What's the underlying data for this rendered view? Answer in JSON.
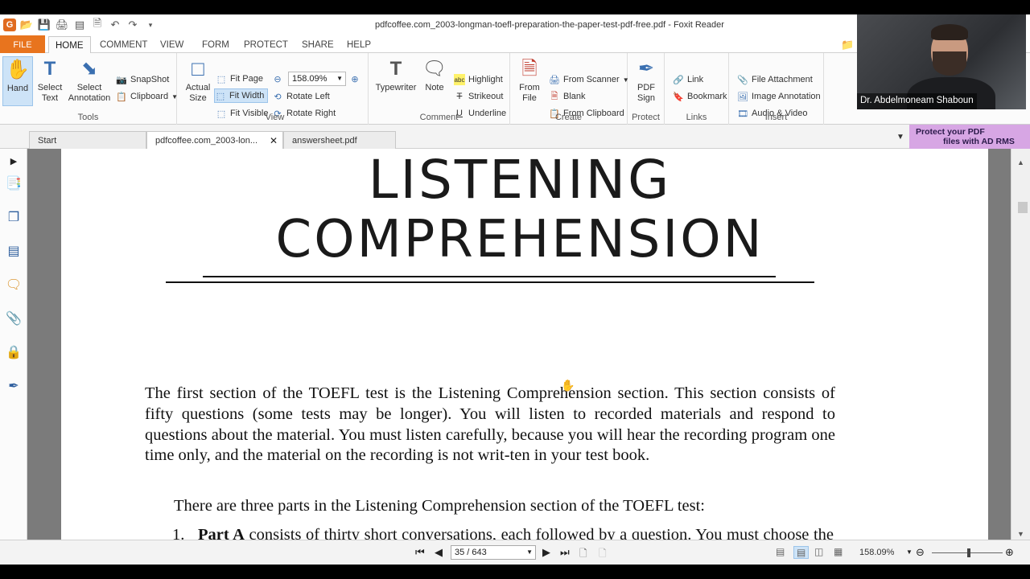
{
  "window": {
    "title": "pdfcoffee.com_2003-longman-toefl-preparation-the-paper-test-pdf-free.pdf - Foxit Reader"
  },
  "ribbon_tabs": [
    {
      "label": "FILE"
    },
    {
      "label": "HOME"
    },
    {
      "label": "COMMENT"
    },
    {
      "label": "VIEW"
    },
    {
      "label": "FORM"
    },
    {
      "label": "PROTECT"
    },
    {
      "label": "SHARE"
    },
    {
      "label": "HELP"
    }
  ],
  "ribbon": {
    "tools": {
      "label": "Tools",
      "hand": "Hand",
      "select_text": "Select Text",
      "select_annotation": "Select Annotation",
      "snapshot": "SnapShot",
      "clipboard": "Clipboard"
    },
    "view": {
      "label": "View",
      "actual_size": "Actual Size",
      "fit_page": "Fit Page",
      "fit_width": "Fit Width",
      "fit_visible": "Fit Visible",
      "zoom_value": "158.09%",
      "rotate_left": "Rotate Left",
      "rotate_right": "Rotate Right"
    },
    "comment": {
      "label": "Comment",
      "typewriter": "Typewriter",
      "note": "Note",
      "highlight": "Highlight",
      "strikeout": "Strikeout",
      "underline": "Underline"
    },
    "create": {
      "label": "Create",
      "from_file": "From File",
      "from_scanner": "From Scanner",
      "blank": "Blank",
      "from_clipboard": "From Clipboard"
    },
    "protect": {
      "label": "Protect",
      "pdf_sign": "PDF Sign"
    },
    "links": {
      "label": "Links",
      "link": "Link",
      "bookmark": "Bookmark"
    },
    "insert": {
      "label": "Insert",
      "file_attachment": "File Attachment",
      "image_annotation": "Image Annotation",
      "audio_video": "Audio & Video"
    }
  },
  "webcam": {
    "name": "Dr. Abdelmoneam Shaboun"
  },
  "doc_tabs": [
    {
      "label": "Start"
    },
    {
      "label": "pdfcoffee.com_2003-lon..."
    },
    {
      "label": "answersheet.pdf"
    }
  ],
  "ad_banner": {
    "line1": "Protect your PDF",
    "line2": "files with AD RMS"
  },
  "document": {
    "heading_line1": "LISTENING",
    "heading_line2": "COMPREHENSION",
    "paragraph1": "The first section of the TOEFL test is the Listening Comprehension section. This section consists of fifty questions (some tests may be longer). You will listen to recorded materials and respond to questions about the material. You must listen carefully, because you will hear the recording program one time only, and the material on the recording is not writ-ten in your test book.",
    "paragraph2": "There are three parts in the Listening Comprehension section of the TOEFL test:",
    "list_item1_number": "1.",
    "list_item1_bold": "Part A",
    "list_item1_text": " consists of thirty short conversations, each followed by a question. You must choose the best answer to each question from the four choices in your test book."
  },
  "statusbar": {
    "page_indicator": "35 / 643",
    "zoom": "158.09%"
  },
  "colors": {
    "file_tab": "#e8741e",
    "selected_button": "#cde3f7",
    "ad_banner": "#d7a6e4",
    "viewer_background": "#7b7b7b"
  }
}
